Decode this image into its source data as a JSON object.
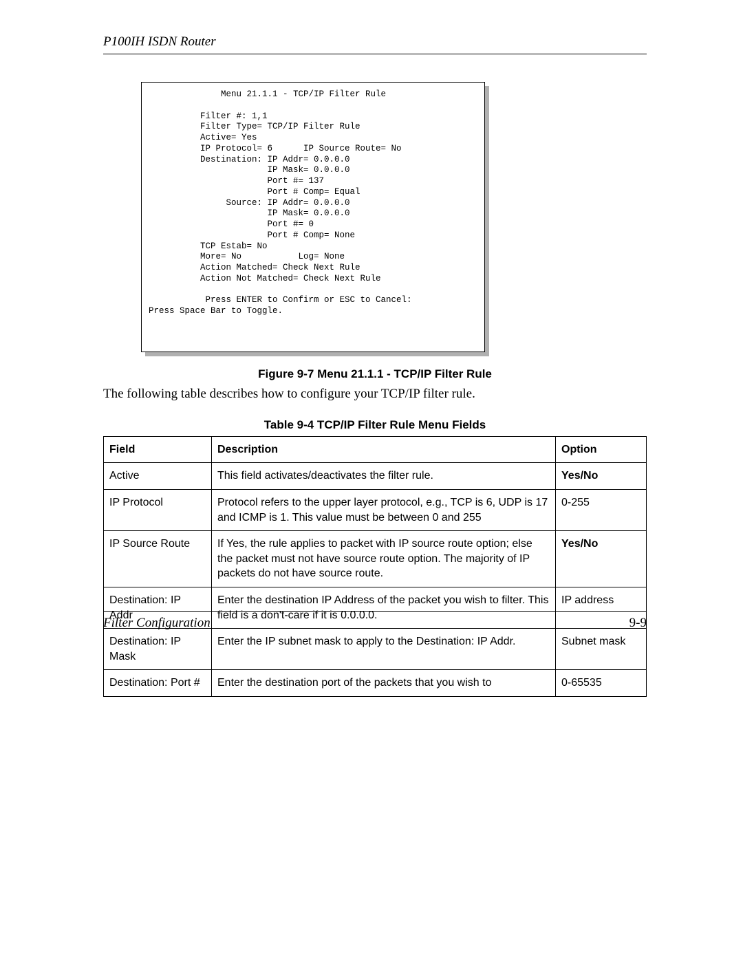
{
  "header": {
    "title": "P100IH ISDN Router"
  },
  "terminal": {
    "text": "              Menu 21.1.1 - TCP/IP Filter Rule\n\n          Filter #: 1,1\n          Filter Type= TCP/IP Filter Rule\n          Active= Yes\n          IP Protocol= 6      IP Source Route= No\n          Destination: IP Addr= 0.0.0.0\n                       IP Mask= 0.0.0.0\n                       Port #= 137\n                       Port # Comp= Equal\n               Source: IP Addr= 0.0.0.0\n                       IP Mask= 0.0.0.0\n                       Port #= 0\n                       Port # Comp= None\n          TCP Estab= No\n          More= No           Log= None\n          Action Matched= Check Next Rule\n          Action Not Matched= Check Next Rule\n\n           Press ENTER to Confirm or ESC to Cancel:\nPress Space Bar to Toggle."
  },
  "figure_caption": "Figure 9-7 Menu 21.1.1 - TCP/IP Filter Rule",
  "intro_text": "The following table describes how to configure your TCP/IP filter rule.",
  "table_caption": "Table 9-4 TCP/IP Filter Rule Menu Fields",
  "table": {
    "headers": {
      "field": "Field",
      "description": "Description",
      "option": "Option"
    },
    "rows": [
      {
        "field": "Active",
        "description": "This field activates/deactivates the filter rule.",
        "option": "Yes/No",
        "option_bold": true
      },
      {
        "field": "IP Protocol",
        "description": "Protocol refers to the upper layer protocol, e.g., TCP is 6, UDP is 17 and ICMP is 1.  This value must be between 0 and 255",
        "option": "0-255",
        "option_bold": false
      },
      {
        "field": "IP Source Route",
        "description": "If Yes, the rule applies to packet with IP source route option; else the packet must not have source route option. The majority of IP packets do not have source route.",
        "option": "Yes/No",
        "option_bold": true
      },
      {
        "field": "Destination: IP Addr",
        "description": "Enter the destination IP Address of the packet you wish to filter.  This field is a don't-care if it is 0.0.0.0.",
        "option": "IP address",
        "option_bold": false
      },
      {
        "field": "Destination: IP Mask",
        "description": "Enter the IP subnet mask to apply to the Destination: IP Addr.",
        "option": "Subnet mask",
        "option_bold": false
      },
      {
        "field": "Destination: Port #",
        "description": "Enter the destination port of the packets that you wish to",
        "option": "0-65535",
        "option_bold": false
      }
    ]
  },
  "footer": {
    "left": "Filter Configuration",
    "right": "9-9"
  }
}
